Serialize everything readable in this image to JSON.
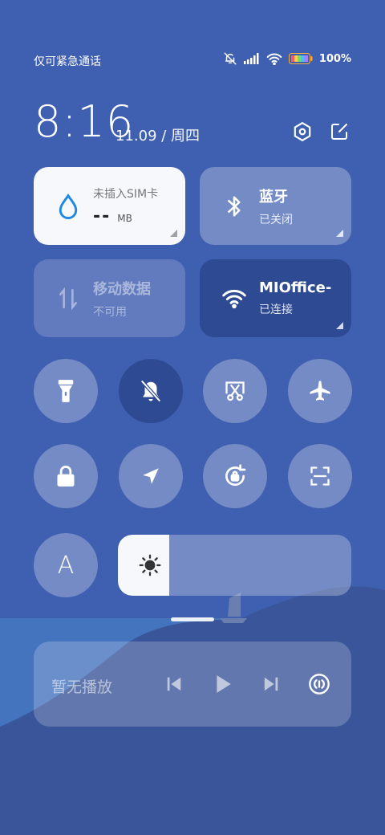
{
  "status": {
    "carrier": "仅可紧急通话",
    "battery": "100%",
    "icons": [
      "bell-muted-icon",
      "signal-icon",
      "wifi-icon",
      "battery-icon"
    ]
  },
  "header": {
    "time": "8:16",
    "date": "11.09 / 周四",
    "icons": [
      "settings-hexagon-icon",
      "edit-icon"
    ]
  },
  "tiles": {
    "sim": {
      "title": "未插入SIM卡",
      "value": "--",
      "unit": "MB",
      "icon": "water-drop-icon"
    },
    "bluetooth": {
      "title": "蓝牙",
      "subtitle": "已关闭",
      "icon": "bluetooth-icon"
    },
    "mobile_data": {
      "title": "移动数据",
      "subtitle": "不可用",
      "icon": "data-arrows-icon"
    },
    "wifi": {
      "title": "MIOffice-",
      "subtitle": "已连接",
      "icon": "wifi-icon"
    }
  },
  "toggles": [
    {
      "name": "flashlight",
      "icon": "flashlight-icon",
      "active": false
    },
    {
      "name": "mute",
      "icon": "bell-muted-icon",
      "active": true
    },
    {
      "name": "screenshot",
      "icon": "scissors-screenshot-icon",
      "active": false
    },
    {
      "name": "airplane-mode",
      "icon": "airplane-icon",
      "active": false
    },
    {
      "name": "lock-screen",
      "icon": "lock-icon",
      "active": false
    },
    {
      "name": "location",
      "icon": "location-arrow-icon",
      "active": false
    },
    {
      "name": "rotation-lock",
      "icon": "rotation-lock-icon",
      "active": false
    },
    {
      "name": "scanner",
      "icon": "scan-icon",
      "active": false
    }
  ],
  "auto_brightness": {
    "label": "A"
  },
  "brightness": {
    "level": 0.22,
    "icon": "sun-icon"
  },
  "media": {
    "status": "暂无播放",
    "controls": [
      "previous-icon",
      "play-icon",
      "next-icon",
      "cast-icon"
    ]
  },
  "colors": {
    "background": "#3f5fb0",
    "active_tile": "#2e4a93",
    "light_tile": "#f6f8fc"
  }
}
